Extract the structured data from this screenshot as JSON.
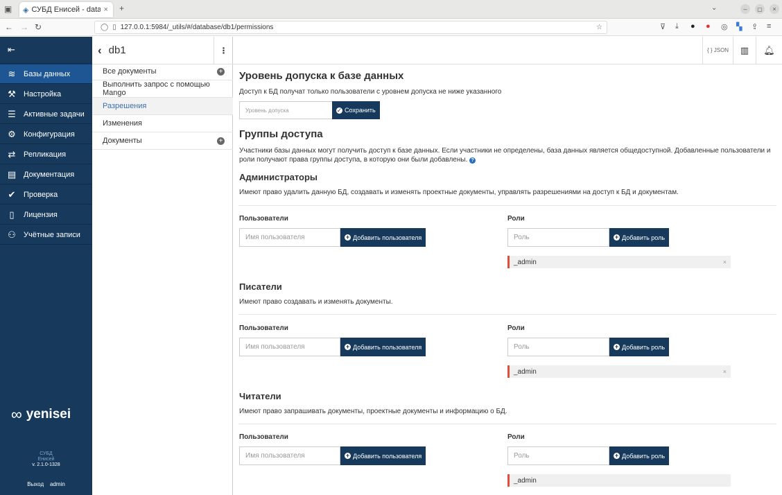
{
  "browser": {
    "tab_title": "СУБД Енисей - database",
    "url": "127.0.0.1:5984/_utils/#/database/db1/permissions"
  },
  "sidebar": {
    "items": [
      {
        "label": "Базы данных",
        "icon": "database-icon"
      },
      {
        "label": "Настройка",
        "icon": "wrench-icon"
      },
      {
        "label": "Активные задачи",
        "icon": "tasks-icon"
      },
      {
        "label": "Конфигурация",
        "icon": "gear-icon"
      },
      {
        "label": "Репликация",
        "icon": "replication-icon"
      },
      {
        "label": "Документация",
        "icon": "book-icon"
      },
      {
        "label": "Проверка",
        "icon": "check-icon"
      },
      {
        "label": "Лицензия",
        "icon": "file-icon"
      },
      {
        "label": "Учётные записи",
        "icon": "users-icon"
      }
    ],
    "logo_text": "yenisei",
    "product": "СУБД",
    "product2": "Енисей",
    "version": "v. 2.1.0-1328",
    "logout": "Выход",
    "user": "admin"
  },
  "db": {
    "name": "db1",
    "nav": [
      "Все документы",
      "Выполнить запрос с помощью Mango",
      "Разрешения",
      "Изменения",
      "Документы"
    ]
  },
  "header": {
    "json": "{ } JSON"
  },
  "level": {
    "title": "Уровень допуска к базе данных",
    "desc": "Доступ к БД получат только пользователи с уровнем допуска не ниже указанного",
    "placeholder": "Уровень допуска",
    "save": "Сохранить"
  },
  "groups": {
    "title": "Группы доступа",
    "desc1": "Участники базы данных могут получить доступ к базе данных. Если участники не определены, база данных является общедоступной. Добавленные пользователи и",
    "desc2": "роли получают права группы доступа, в которую они были добавлены."
  },
  "common": {
    "users": "Пользователи",
    "roles": "Роли",
    "user_ph": "Имя пользователя",
    "role_ph": "Роль",
    "add_user": "Добавить пользователя",
    "add_role": "Добавить роль"
  },
  "sections": [
    {
      "title": "Администраторы",
      "desc": "Имеют право удалить данную БД, создавать и изменять проектные документы, управлять разрешениями на доступ к БД и документам.",
      "role": "_admin"
    },
    {
      "title": "Писатели",
      "desc": "Имеют право создавать и изменять документы.",
      "role": "_admin"
    },
    {
      "title": "Читатели",
      "desc": "Имеют право запрашивать документы, проектные документы и информацию о БД.",
      "role": "_admin"
    }
  ]
}
